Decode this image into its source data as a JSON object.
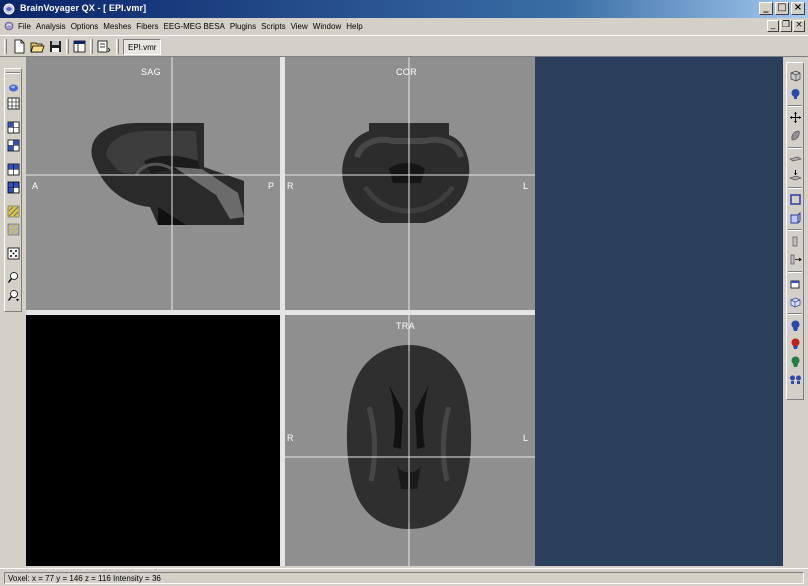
{
  "window": {
    "title": "BrainVoyager QX - [ EPI.vmr]",
    "buttons": {
      "minimize": "_",
      "maximize": "□",
      "close": "×"
    }
  },
  "menu": {
    "items": [
      "File",
      "Analysis",
      "Options",
      "Meshes",
      "Fibers",
      "EEG-MEG BESA",
      "Plugins",
      "Scripts",
      "View",
      "Window",
      "Help"
    ],
    "mdi_buttons": {
      "minimize": "_",
      "restore": "❐",
      "close": "×"
    }
  },
  "toolbar": {
    "icons": [
      "new-document-icon",
      "open-folder-icon",
      "save-disk-icon",
      "window-layout-icon",
      "document-list-icon"
    ],
    "document_tab": "EPI.vmr"
  },
  "left_tools": [
    "brain-3d-icon",
    "grid-1x1-icon",
    "grid-2x2-a-icon",
    "grid-2x2-b-icon",
    "grid-2x2-c-icon",
    "grid-2x2-d-icon",
    "slices-a-icon",
    "slices-b-icon",
    "dice-icon",
    "zoom-in-icon",
    "zoom-out-icon"
  ],
  "right_tools": [
    "cube-tool-icon",
    "head-view-icon",
    "move-arrows-icon",
    "leaf-icon",
    "slice-plane-icon",
    "stack-icon",
    "square-frame-icon",
    "volume-box-icon",
    "pin-icon",
    "pin-arrow-icon",
    "box-open-icon",
    "box-3d-icon",
    "head-blue-icon",
    "head-red-icon",
    "head-green-icon",
    "heads-pair-icon"
  ],
  "views": {
    "sagittal": {
      "title": "SAG",
      "left_label": "A",
      "right_label": "P"
    },
    "coronal": {
      "title": "COR",
      "left_label": "R",
      "right_label": "L"
    },
    "transverse": {
      "title": "TRA",
      "left_label": "R",
      "right_label": "L"
    }
  },
  "colors": {
    "workspace_background": "#2b3e5c",
    "slice_background": "#8f8f8f",
    "title_bar_start": "#0a246a"
  },
  "status": {
    "text": "Voxel:  x = 77  y = 146  z = 116  Intensity = 36"
  }
}
